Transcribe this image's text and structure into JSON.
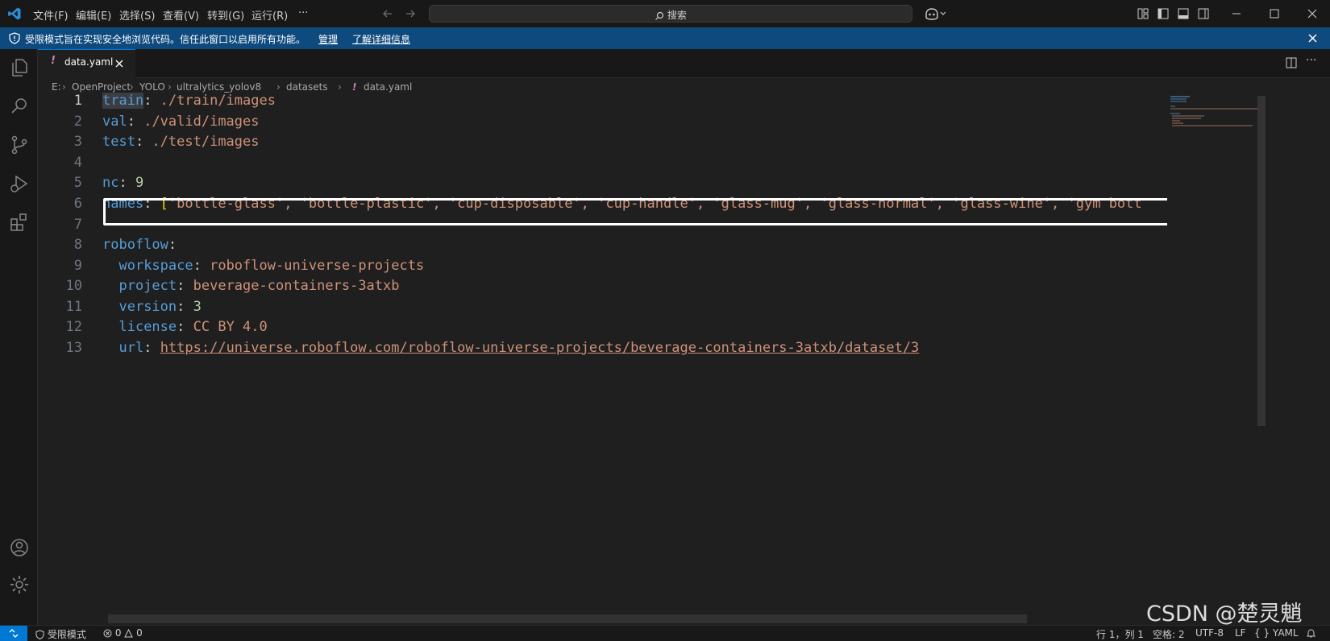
{
  "menu": [
    "文件(F)",
    "编辑(E)",
    "选择(S)",
    "查看(V)",
    "转到(G)",
    "运行(R)",
    "···"
  ],
  "search": {
    "placeholder": "搜索"
  },
  "banner": {
    "message": "受限模式旨在实现安全地浏览代码。信任此窗口以启用所有功能。",
    "manage": "管理",
    "learn_more": "了解详细信息"
  },
  "tab": {
    "icon": "!",
    "name": "data.yaml"
  },
  "breadcrumb": [
    "E:",
    "OpenProject",
    "YOLO",
    "ultralytics_yolov8",
    "datasets",
    "data.yaml"
  ],
  "editor": {
    "line_numbers": [
      "1",
      "2",
      "3",
      "4",
      "5",
      "6",
      "7",
      "8",
      "9",
      "10",
      "11",
      "12",
      "13"
    ],
    "lines": [
      {
        "key": "train",
        "value": "./train/images"
      },
      {
        "key": "val",
        "value": "./valid/images"
      },
      {
        "key": "test",
        "value": "./test/images"
      },
      {},
      {
        "key": "nc",
        "value": "9"
      },
      {
        "key": "names",
        "value": "['bottle-glass', 'bottle-plastic', 'cup-disposable', 'cup-handle', 'glass-mug', 'glass-normal', 'glass-wine', 'gym bott"
      },
      {},
      {
        "key": "roboflow",
        "value": ""
      },
      {
        "key": "workspace",
        "value": "roboflow-universe-projects"
      },
      {
        "key": "project",
        "value": "beverage-containers-3atxb"
      },
      {
        "key": "version",
        "value": "3"
      },
      {
        "key": "license",
        "value": "CC BY 4.0"
      },
      {
        "key": "url",
        "value": "https://universe.roboflow.com/roboflow-universe-projects/beverage-containers-3atxb/dataset/3"
      }
    ]
  },
  "status": {
    "restricted": "受限模式",
    "errors": "0",
    "warnings": "0",
    "position": "行 1，列 1",
    "spaces": "空格: 2",
    "encoding": "UTF-8",
    "eol": "LF",
    "language": "YAML"
  },
  "watermark": "CSDN @楚灵魈",
  "colors": {
    "accent": "#0078d4",
    "banner": "#0e4a7d",
    "key": "#569cd6",
    "string": "#ce9178",
    "number": "#b5cea8"
  }
}
